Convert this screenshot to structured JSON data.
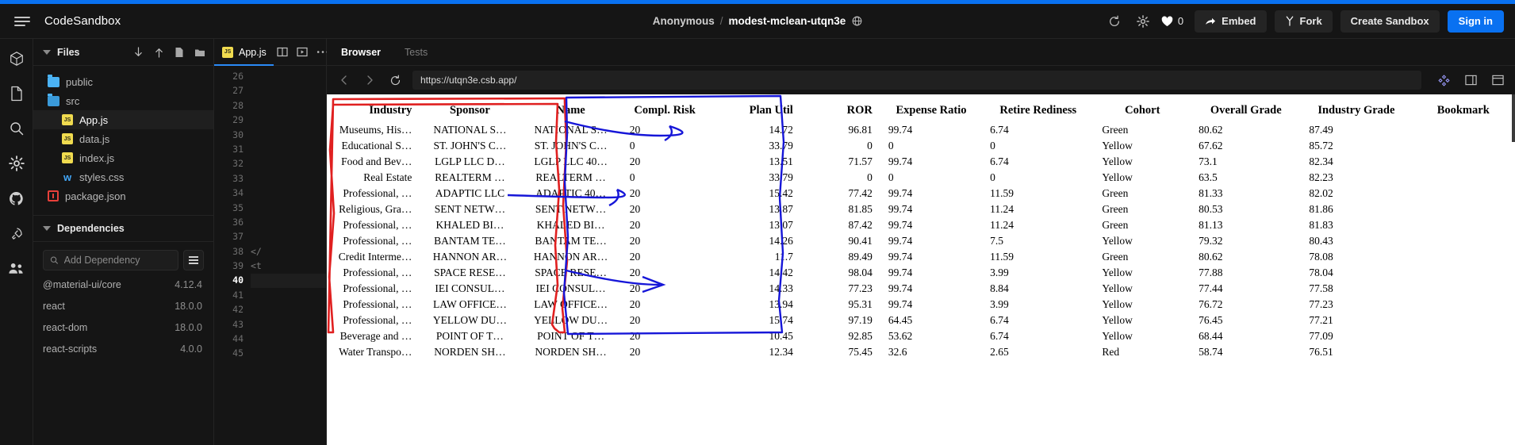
{
  "header": {
    "brand": "CodeSandbox",
    "owner": "Anonymous",
    "separator": "/",
    "sandbox_name": "modest-mclean-utqn3e",
    "like_count": "0",
    "embed_label": "Embed",
    "fork_label": "Fork",
    "create_label": "Create Sandbox",
    "signin_label": "Sign in",
    "accent_color": "#0971f1"
  },
  "sidebar": {
    "files_title": "Files",
    "tree": [
      {
        "label": "public",
        "type": "folder",
        "indent": 0,
        "active": false
      },
      {
        "label": "src",
        "type": "folder-open",
        "indent": 0,
        "active": false
      },
      {
        "label": "App.js",
        "type": "js",
        "indent": 1,
        "active": true
      },
      {
        "label": "data.js",
        "type": "js",
        "indent": 1,
        "active": false
      },
      {
        "label": "index.js",
        "type": "js",
        "indent": 1,
        "active": false
      },
      {
        "label": "styles.css",
        "type": "css",
        "indent": 1,
        "active": false
      },
      {
        "label": "package.json",
        "type": "npm",
        "indent": 0,
        "active": false
      }
    ],
    "dependencies_title": "Dependencies",
    "add_dependency_placeholder": "Add Dependency",
    "add_dependency_value": "",
    "dependencies": [
      {
        "name": "@material-ui/core",
        "version": "4.12.4"
      },
      {
        "name": "react",
        "version": "18.0.0"
      },
      {
        "name": "react-dom",
        "version": "18.0.0"
      },
      {
        "name": "react-scripts",
        "version": "4.0.0"
      }
    ]
  },
  "editor": {
    "tab_label": "App.js",
    "line_numbers": [
      "26",
      "27",
      "28",
      "29",
      "30",
      "31",
      "32",
      "33",
      "34",
      "35",
      "36",
      "37",
      "38",
      "39",
      "40",
      "41",
      "42",
      "43",
      "44",
      "45"
    ],
    "current_line": "40",
    "code_lines": [
      "",
      "",
      "",
      "",
      "",
      "",
      "",
      "",
      "",
      "",
      "",
      "",
      "</",
      "<t",
      "",
      "",
      "",
      "",
      "",
      ""
    ]
  },
  "preview": {
    "tabs": [
      {
        "label": "Browser",
        "active": true
      },
      {
        "label": "Tests",
        "active": false
      }
    ],
    "url": "https://utqn3e.csb.app/"
  },
  "table": {
    "columns": [
      "Industry",
      "Sponsor",
      "Name",
      "Compl. Risk",
      "Plan Util",
      "ROR",
      "Expense Ratio",
      "Retire Rediness",
      "Cohort",
      "Overall Grade",
      "Industry Grade",
      "Bookmark"
    ],
    "rows": [
      [
        "Museums, His…",
        "NATIONAL S…",
        "NATIONAL S…",
        "20",
        "14.72",
        "96.81",
        "99.74",
        "6.74",
        "Green",
        "80.62",
        "87.49",
        ""
      ],
      [
        "Educational S…",
        "ST. JOHN'S C…",
        "ST. JOHN'S C…",
        "0",
        "33.79",
        "0",
        "0",
        "0",
        "Yellow",
        "67.62",
        "85.72",
        ""
      ],
      [
        "Food and Bev…",
        "LGLP LLC D…",
        "LGLP LLC 40…",
        "20",
        "13.51",
        "71.57",
        "99.74",
        "6.74",
        "Yellow",
        "73.1",
        "82.34",
        ""
      ],
      [
        "Real Estate",
        "REALTERM …",
        "REALTERM …",
        "0",
        "33.79",
        "0",
        "0",
        "0",
        "Yellow",
        "63.5",
        "82.23",
        ""
      ],
      [
        "Professional, …",
        "ADAPTIC LLC",
        "ADAPTIC 40…",
        "20",
        "15.42",
        "77.42",
        "99.74",
        "11.59",
        "Green",
        "81.33",
        "82.02",
        ""
      ],
      [
        "Religious, Gra…",
        "SENT NETW…",
        "SENT NETW…",
        "20",
        "13.87",
        "81.85",
        "99.74",
        "11.24",
        "Green",
        "80.53",
        "81.86",
        ""
      ],
      [
        "Professional, …",
        "KHALED BI…",
        "KHALED BI…",
        "20",
        "13.07",
        "87.42",
        "99.74",
        "11.24",
        "Green",
        "81.13",
        "81.83",
        ""
      ],
      [
        "Professional, …",
        "BANTAM TE…",
        "BANTAM TE…",
        "20",
        "14.26",
        "90.41",
        "99.74",
        "7.5",
        "Yellow",
        "79.32",
        "80.43",
        ""
      ],
      [
        "Credit Interme…",
        "HANNON AR…",
        "HANNON AR…",
        "20",
        "11.7",
        "89.49",
        "99.74",
        "11.59",
        "Green",
        "80.62",
        "78.08",
        ""
      ],
      [
        "Professional, …",
        "SPACE RESE…",
        "SPACE RESE…",
        "20",
        "14.42",
        "98.04",
        "99.74",
        "3.99",
        "Yellow",
        "77.88",
        "78.04",
        ""
      ],
      [
        "Professional, …",
        "IEI CONSUL…",
        "IEI CONSUL…",
        "20",
        "14.33",
        "77.23",
        "99.74",
        "8.84",
        "Yellow",
        "77.44",
        "77.58",
        ""
      ],
      [
        "Professional, …",
        "LAW OFFICE…",
        "LAW OFFICE…",
        "20",
        "13.94",
        "95.31",
        "99.74",
        "3.99",
        "Yellow",
        "76.72",
        "77.23",
        ""
      ],
      [
        "Professional, …",
        "YELLOW DU…",
        "YELLOW DU…",
        "20",
        "15.74",
        "97.19",
        "64.45",
        "6.74",
        "Yellow",
        "76.45",
        "77.21",
        ""
      ],
      [
        "Beverage and …",
        "POINT OF T…",
        "POINT OF T…",
        "20",
        "10.45",
        "92.85",
        "53.62",
        "6.74",
        "Yellow",
        "68.44",
        "77.09",
        ""
      ],
      [
        "Water Transpo…",
        "NORDEN SH…",
        "NORDEN SH…",
        "20",
        "12.34",
        "75.45",
        "32.6",
        "2.65",
        "Red",
        "58.74",
        "76.51",
        ""
      ]
    ],
    "annotations": {
      "red_outline_color": "#e02020",
      "blue_outline_color": "#1616d8"
    }
  }
}
